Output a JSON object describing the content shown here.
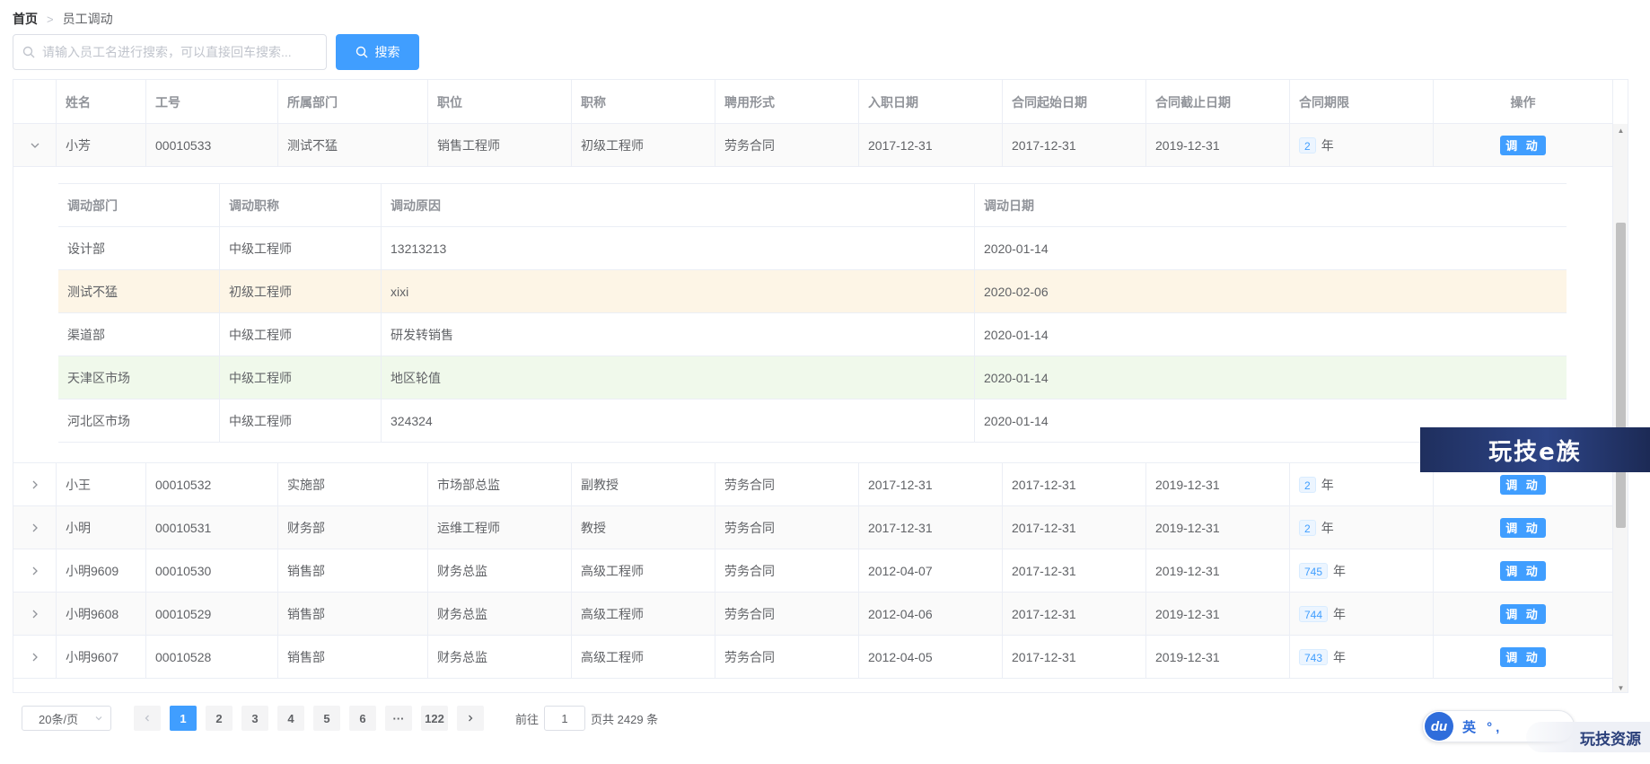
{
  "breadcrumb": {
    "home": "首页",
    "current": "员工调动"
  },
  "search": {
    "placeholder": "请输入员工名进行搜索，可以直接回车搜索...",
    "value": "",
    "button_label": "搜索"
  },
  "table": {
    "columns": [
      "姓名",
      "工号",
      "所属部门",
      "职位",
      "职称",
      "聘用形式",
      "入职日期",
      "合同起始日期",
      "合同截止日期",
      "合同期限",
      "操作"
    ],
    "action_label": "调 动",
    "years_unit": "年",
    "expanded_row": {
      "name": "小芳",
      "id": "00010533",
      "dept": "测试不猛",
      "position": "销售工程师",
      "title": "初级工程师",
      "employ": "劳务合同",
      "join": "2017-12-31",
      "start": "2017-12-31",
      "end": "2019-12-31",
      "term": "2"
    },
    "detail": {
      "columns": [
        "调动部门",
        "调动职称",
        "调动原因",
        "调动日期"
      ],
      "rows": [
        {
          "dept": "设计部",
          "title": "中级工程师",
          "reason": "13213213",
          "date": "2020-01-14",
          "style": ""
        },
        {
          "dept": "测试不猛",
          "title": "初级工程师",
          "reason": "xixi",
          "date": "2020-02-06",
          "style": "warn"
        },
        {
          "dept": "渠道部",
          "title": "中级工程师",
          "reason": "研发转销售",
          "date": "2020-01-14",
          "style": ""
        },
        {
          "dept": "天津区市场",
          "title": "中级工程师",
          "reason": "地区轮值",
          "date": "2020-01-14",
          "style": "succ"
        },
        {
          "dept": "河北区市场",
          "title": "中级工程师",
          "reason": "324324",
          "date": "2020-01-14",
          "style": ""
        }
      ]
    },
    "rows": [
      {
        "name": "小王",
        "id": "00010532",
        "dept": "实施部",
        "position": "市场部总监",
        "title": "副教授",
        "employ": "劳务合同",
        "join": "2017-12-31",
        "start": "2017-12-31",
        "end": "2019-12-31",
        "term": "2"
      },
      {
        "name": "小明",
        "id": "00010531",
        "dept": "财务部",
        "position": "运维工程师",
        "title": "教授",
        "employ": "劳务合同",
        "join": "2017-12-31",
        "start": "2017-12-31",
        "end": "2019-12-31",
        "term": "2"
      },
      {
        "name": "小明9609",
        "id": "00010530",
        "dept": "销售部",
        "position": "财务总监",
        "title": "高级工程师",
        "employ": "劳务合同",
        "join": "2012-04-07",
        "start": "2017-12-31",
        "end": "2019-12-31",
        "term": "745"
      },
      {
        "name": "小明9608",
        "id": "00010529",
        "dept": "销售部",
        "position": "财务总监",
        "title": "高级工程师",
        "employ": "劳务合同",
        "join": "2012-04-06",
        "start": "2017-12-31",
        "end": "2019-12-31",
        "term": "744"
      },
      {
        "name": "小明9607",
        "id": "00010528",
        "dept": "销售部",
        "position": "财务总监",
        "title": "高级工程师",
        "employ": "劳务合同",
        "join": "2012-04-05",
        "start": "2017-12-31",
        "end": "2019-12-31",
        "term": "743"
      }
    ]
  },
  "pagination": {
    "page_size_label": "20条/页",
    "pages": [
      "1",
      "2",
      "3",
      "4",
      "5",
      "6",
      "···",
      "122"
    ],
    "current_page": "1",
    "goto_prefix": "前往",
    "goto_value": "1",
    "goto_suffix": "页",
    "total_text": "共 2429 条"
  },
  "overlays": {
    "banner_text": "玩技e族",
    "ime_badge": "du",
    "ime_text": "英 °,",
    "bottom_watermark": "玩技资源"
  },
  "colors": {
    "primary": "#409eff",
    "warning_row": "#fdf5e6",
    "success_row": "#f0f9eb",
    "border": "#ebeef5"
  }
}
